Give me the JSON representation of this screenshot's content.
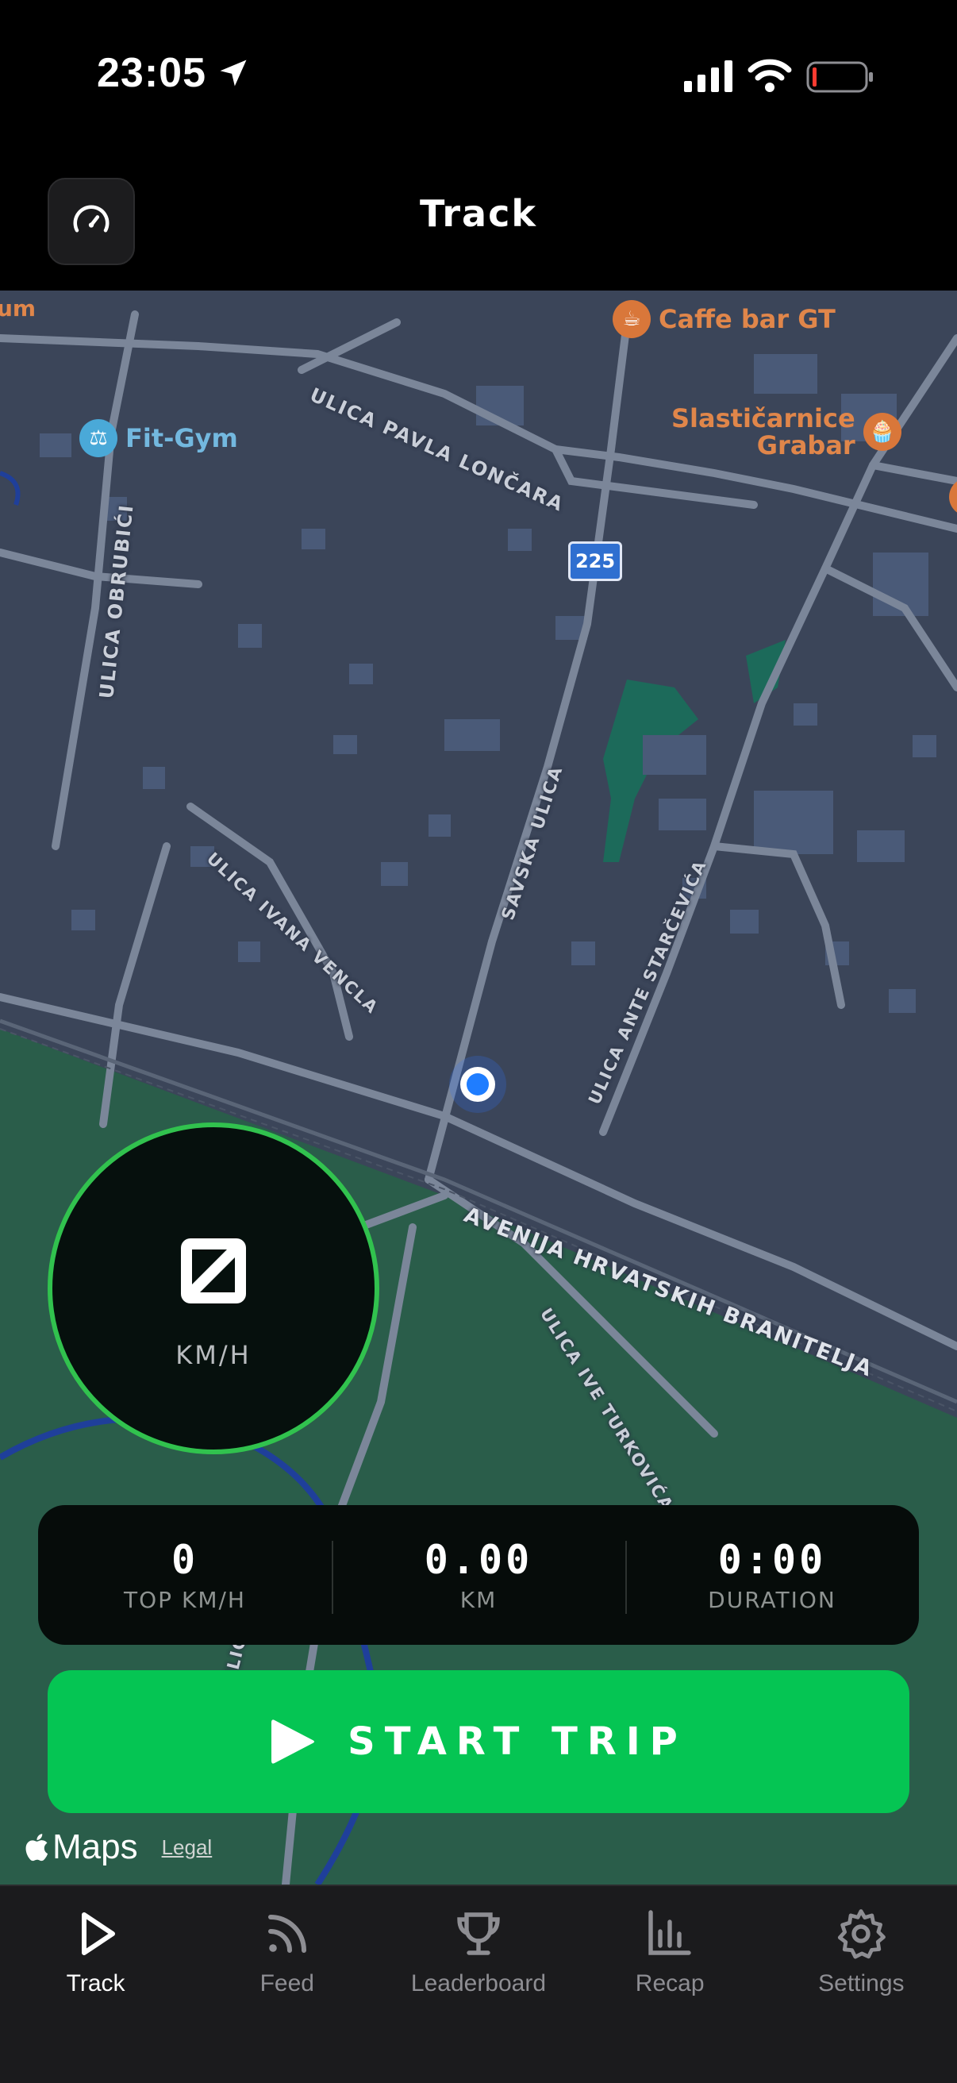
{
  "status_bar": {
    "time": "23:05"
  },
  "header": {
    "title": "Track",
    "left_icon": "speedometer-icon"
  },
  "map": {
    "pois": [
      {
        "name": "Caffe bar GT",
        "icon": "coffee-cup-icon",
        "color": "#d9773a"
      },
      {
        "name": "Slastičarnice\nGrabar",
        "icon": "cupcake-icon",
        "color": "#d9773a"
      },
      {
        "name": "Fit-Gym",
        "icon": "dumbbell-icon",
        "color": "#4aa9d8"
      },
      {
        "name": "um",
        "icon": "",
        "color": "#d9773a"
      }
    ],
    "streets": [
      "ULICA PAVLA LONČARA",
      "ULICA OBRUBIĆI",
      "SAVSKA ULICA",
      "ULICA IVANA VENCLA",
      "ULICA ANTE STARČEVIĆA",
      "AVENIJA HRVATSKIH BRANITELJA",
      "ULICA IVE TURKOVIĆA",
      "A ULIC"
    ],
    "route_badge": "225"
  },
  "gauge": {
    "unit": "KM/H",
    "speed_display": "unavailable",
    "accent_color": "#31c24e"
  },
  "stats": [
    {
      "value": "0",
      "label": "TOP KM/H"
    },
    {
      "value": "0.00",
      "label": "KM"
    },
    {
      "value": "0:00",
      "label": "DURATION"
    }
  ],
  "start_button": {
    "label": "START TRIP",
    "color": "#05c553"
  },
  "attribution": {
    "maps": "Maps",
    "legal": "Legal"
  },
  "tabbar": {
    "tabs": [
      {
        "label": "Track",
        "icon": "play-icon",
        "active": true
      },
      {
        "label": "Feed",
        "icon": "feed-icon",
        "active": false
      },
      {
        "label": "Leaderboard",
        "icon": "trophy-icon",
        "active": false
      },
      {
        "label": "Recap",
        "icon": "bar-chart-icon",
        "active": false
      },
      {
        "label": "Settings",
        "icon": "gear-icon",
        "active": false
      }
    ]
  }
}
